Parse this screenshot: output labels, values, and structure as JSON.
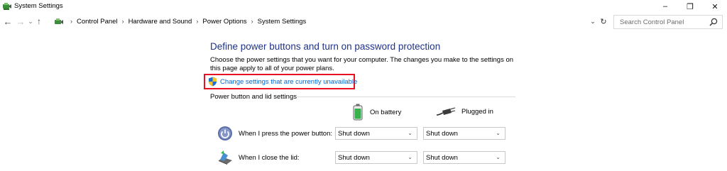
{
  "window": {
    "title": "System Settings",
    "minimize_glyph": "–",
    "maximize_glyph": "❐",
    "close_glyph": "✕"
  },
  "nav": {
    "back_glyph": "←",
    "forward_glyph": "→",
    "recent_glyph": "⌄",
    "up_glyph": "↑"
  },
  "breadcrumb": {
    "items": [
      "Control Panel",
      "Hardware and Sound",
      "Power Options",
      "System Settings"
    ],
    "separator": "›",
    "dropdown_glyph": "⌄",
    "refresh_glyph": "↻"
  },
  "search": {
    "placeholder": "Search Control Panel",
    "icon": "search-icon"
  },
  "main": {
    "heading": "Define power buttons and turn on password protection",
    "description": "Choose the power settings that you want for your computer. The changes you make to the settings on this page apply to all of your power plans.",
    "change_link": "Change settings that are currently unavailable",
    "highlight_color": "#e81123",
    "section_label": "Power button and lid settings"
  },
  "columns": {
    "on_battery": "On battery",
    "plugged_in": "Plugged in"
  },
  "rows": [
    {
      "label": "When I press the power button:",
      "icon": "power-button-icon",
      "on_battery": "Shut down",
      "plugged_in": "Shut down"
    },
    {
      "label": "When I close the lid:",
      "icon": "laptop-lid-icon",
      "on_battery": "Shut down",
      "plugged_in": "Shut down"
    }
  ],
  "colors": {
    "heading": "#1e3287",
    "link": "#0066cc"
  }
}
